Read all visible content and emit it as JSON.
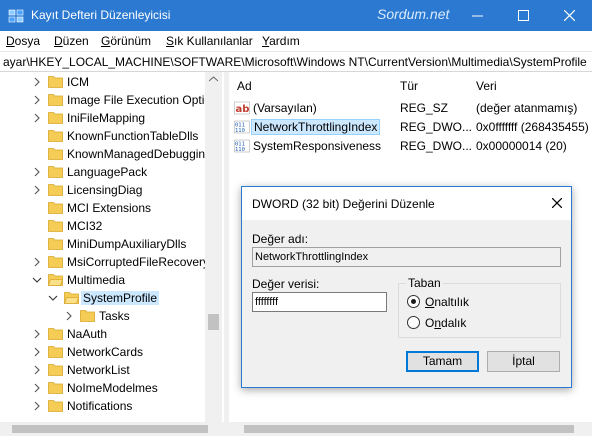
{
  "window": {
    "title": "Kayıt Defteri Düzenleyicisi",
    "watermark": "Sordum.net",
    "icon": "regedit-icon"
  },
  "menu": [
    {
      "label": "Dosya",
      "accel": "D"
    },
    {
      "label": "Düzen",
      "accel": "D"
    },
    {
      "label": "Görünüm",
      "accel": "G"
    },
    {
      "label": "Sık Kullanılanlar",
      "accel": "S"
    },
    {
      "label": "Yardım",
      "accel": "Y"
    }
  ],
  "address": "ayar\\HKEY_LOCAL_MACHINE\\SOFTWARE\\Microsoft\\Windows NT\\CurrentVersion\\Multimedia\\SystemProfile",
  "tree": [
    {
      "label": "ICM",
      "level": 0,
      "expander": ">"
    },
    {
      "label": "Image File Execution Optic",
      "level": 0,
      "expander": ">"
    },
    {
      "label": "IniFileMapping",
      "level": 0,
      "expander": ">"
    },
    {
      "label": "KnownFunctionTableDlls",
      "level": 0,
      "expander": ""
    },
    {
      "label": "KnownManagedDebuggin",
      "level": 0,
      "expander": ""
    },
    {
      "label": "LanguagePack",
      "level": 0,
      "expander": ">"
    },
    {
      "label": "LicensingDiag",
      "level": 0,
      "expander": ">"
    },
    {
      "label": "MCI Extensions",
      "level": 0,
      "expander": ""
    },
    {
      "label": "MCI32",
      "level": 0,
      "expander": ""
    },
    {
      "label": "MiniDumpAuxiliaryDlls",
      "level": 0,
      "expander": ""
    },
    {
      "label": "MsiCorruptedFileRecovery",
      "level": 0,
      "expander": ">"
    },
    {
      "label": "Multimedia",
      "level": 0,
      "expander": "v"
    },
    {
      "label": "SystemProfile",
      "level": 1,
      "expander": "v",
      "selected": true
    },
    {
      "label": "Tasks",
      "level": 2,
      "expander": ">"
    },
    {
      "label": "NaAuth",
      "level": 0,
      "expander": ">"
    },
    {
      "label": "NetworkCards",
      "level": 0,
      "expander": ">"
    },
    {
      "label": "NetworkList",
      "level": 0,
      "expander": ">"
    },
    {
      "label": "NoImeModelmes",
      "level": 0,
      "expander": ">"
    },
    {
      "label": "Notifications",
      "level": 0,
      "expander": ">"
    }
  ],
  "list": {
    "columns": {
      "name": "Ad",
      "type": "Tür",
      "data": "Veri"
    },
    "rows": [
      {
        "icon": "string-value-icon",
        "name": "(Varsayılan)",
        "type": "REG_SZ",
        "data": "(değer atanmamış)"
      },
      {
        "icon": "binary-value-icon",
        "name": "NetworkThrottlingIndex",
        "type": "REG_DWO...",
        "data": "0x0fffffff (268435455)",
        "selected": true
      },
      {
        "icon": "binary-value-icon",
        "name": "SystemResponsiveness",
        "type": "REG_DWO...",
        "data": "0x00000014 (20)"
      }
    ]
  },
  "dialog": {
    "title": "DWORD (32 bit) Değerini Düzenle",
    "name_label": "Değer adı:",
    "name_value": "NetworkThrottlingIndex",
    "data_label": "Değer verisi:",
    "data_value": "ffffffff",
    "base_label": "Taban",
    "base_options": [
      {
        "label": "Onaltılık",
        "accel": "O",
        "checked": true
      },
      {
        "label": "Ondalık",
        "accel": "n",
        "checked": false
      }
    ],
    "ok": "Tamam",
    "cancel": "İptal"
  },
  "colors": {
    "titlebar": "#2b79d0",
    "selection": "#cce8ff",
    "folder": "#f5cd56"
  }
}
